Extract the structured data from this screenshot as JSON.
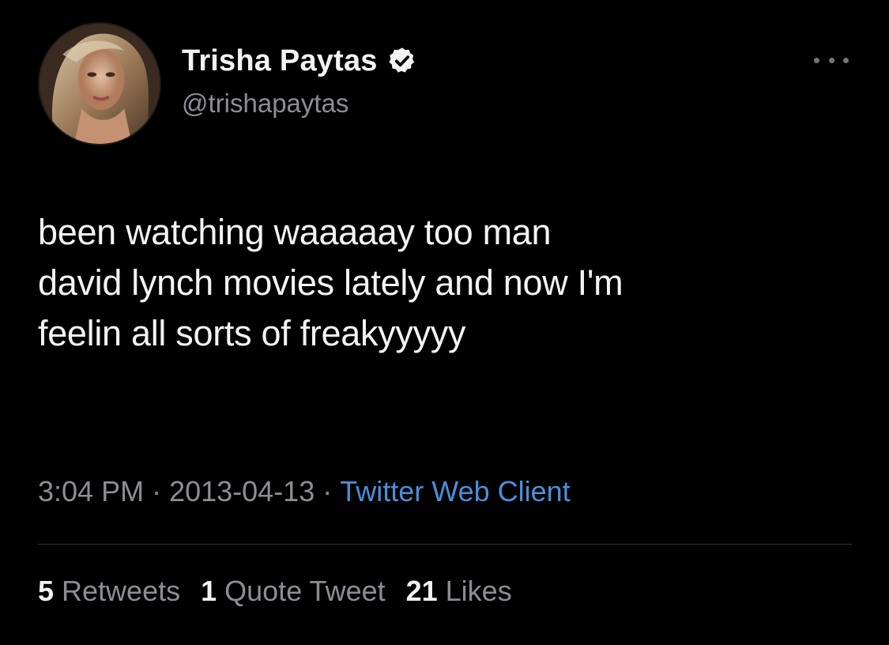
{
  "user": {
    "display_name": "Trisha Paytas",
    "handle": "@trishapaytas",
    "verified_icon": "verified-badge-icon",
    "avatar_icon": "profile-photo"
  },
  "tweet": {
    "lines": [
      "been watching waaaaay too man",
      "david lynch movies lately and now I'm",
      "feelin all sorts of freakyyyyy"
    ]
  },
  "meta": {
    "time": "3:04 PM",
    "separator": "·",
    "date": "2013-04-13",
    "source": "Twitter Web Client"
  },
  "stats": {
    "retweets_count": "5",
    "retweets_label": "Retweets",
    "quotes_count": "1",
    "quotes_label": "Quote Tweet",
    "likes_count": "21",
    "likes_label": "Likes"
  },
  "colors": {
    "background": "#000000",
    "text": "#f3f3f3",
    "secondary_text": "#8b8f94",
    "link": "#4a90d9",
    "divider": "#2f3336"
  }
}
